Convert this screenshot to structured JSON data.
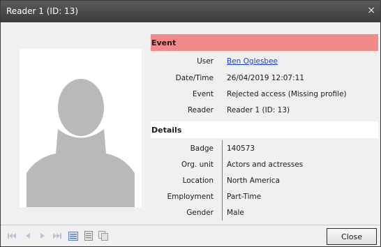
{
  "window": {
    "title": "Reader 1 (ID: 13)",
    "close_glyph": "×"
  },
  "event_section": {
    "header": "Event",
    "header_color": "#f28a8a",
    "rows": [
      {
        "label": "User",
        "value": "Ben Oglesbee"
      },
      {
        "label": "Date/Time",
        "value": "26/04/2019 12:07:11"
      },
      {
        "label": "Event",
        "value": "Rejected access (Missing profile)"
      },
      {
        "label": "Reader",
        "value": "Reader 1 (ID: 13)"
      }
    ]
  },
  "details_section": {
    "header": "Details",
    "rows": [
      {
        "label": "Badge",
        "value": "140573"
      },
      {
        "label": "Org. unit",
        "value": "Actors and actresses"
      },
      {
        "label": "Location",
        "value": "North America"
      },
      {
        "label": "Employment",
        "value": "Part-Time"
      },
      {
        "label": "Gender",
        "value": "Male"
      }
    ]
  },
  "photo": {
    "icon": "person-silhouette-icon"
  },
  "navigation": {
    "icons": [
      "first-icon",
      "previous-icon",
      "next-icon",
      "last-icon",
      "list-icon",
      "document-icon",
      "copy-icon"
    ]
  },
  "footer": {
    "close_label": "Close"
  }
}
